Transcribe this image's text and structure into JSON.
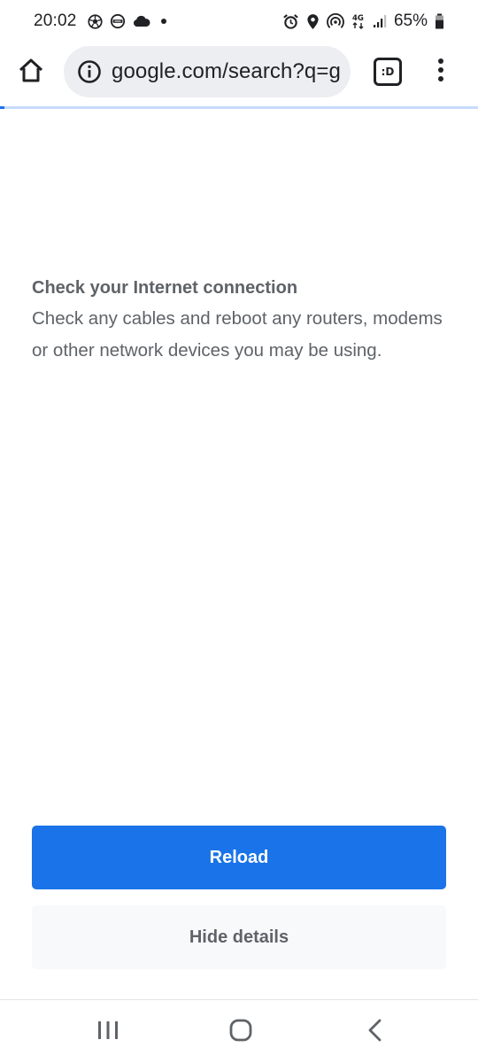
{
  "status_bar": {
    "time": "20:02",
    "left_icons": [
      "soccer-ball-icon",
      "vpn-icon",
      "cloud-icon",
      "dot-icon"
    ],
    "right_icons": [
      "alarm-icon",
      "location-icon",
      "hotspot-icon",
      "4g-icon",
      "signal-icon"
    ],
    "network_type": "4G",
    "battery_percent": "65%",
    "battery_level": 0.65
  },
  "toolbar": {
    "url": "google.com/search?q=g",
    "tab_switcher_label": ":D"
  },
  "progress": {
    "fraction": 0.01,
    "accent_color": "#1a73e8"
  },
  "error": {
    "heading": "Check your Internet connection",
    "body": "Check any cables and reboot any routers, modems or other network devices you may be using."
  },
  "buttons": {
    "reload_label": "Reload",
    "details_label": "Hide details",
    "reload_color": "#1a73e8"
  },
  "nav_bar": {
    "icons": [
      "recents-icon",
      "home-nav-icon",
      "back-icon"
    ]
  }
}
